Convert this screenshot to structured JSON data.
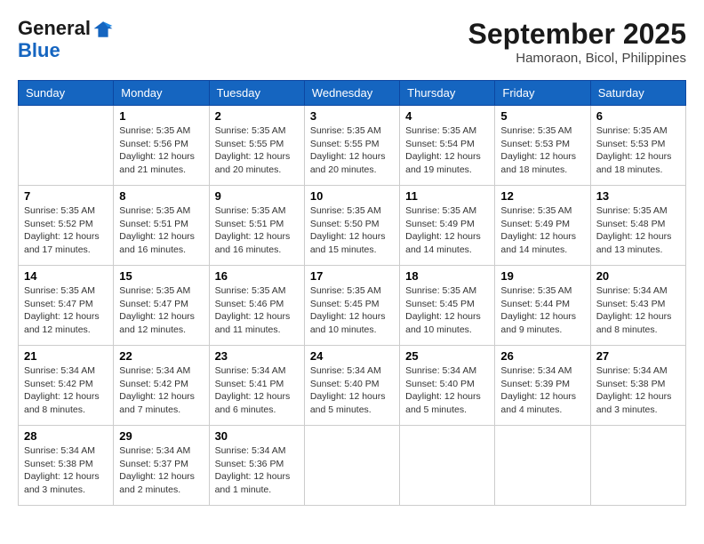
{
  "header": {
    "logo_line1": "General",
    "logo_line2": "Blue",
    "month": "September 2025",
    "location": "Hamoraon, Bicol, Philippines"
  },
  "days_of_week": [
    "Sunday",
    "Monday",
    "Tuesday",
    "Wednesday",
    "Thursday",
    "Friday",
    "Saturday"
  ],
  "weeks": [
    [
      {
        "day": "",
        "info": ""
      },
      {
        "day": "1",
        "info": "Sunrise: 5:35 AM\nSunset: 5:56 PM\nDaylight: 12 hours\nand 21 minutes."
      },
      {
        "day": "2",
        "info": "Sunrise: 5:35 AM\nSunset: 5:55 PM\nDaylight: 12 hours\nand 20 minutes."
      },
      {
        "day": "3",
        "info": "Sunrise: 5:35 AM\nSunset: 5:55 PM\nDaylight: 12 hours\nand 20 minutes."
      },
      {
        "day": "4",
        "info": "Sunrise: 5:35 AM\nSunset: 5:54 PM\nDaylight: 12 hours\nand 19 minutes."
      },
      {
        "day": "5",
        "info": "Sunrise: 5:35 AM\nSunset: 5:53 PM\nDaylight: 12 hours\nand 18 minutes."
      },
      {
        "day": "6",
        "info": "Sunrise: 5:35 AM\nSunset: 5:53 PM\nDaylight: 12 hours\nand 18 minutes."
      }
    ],
    [
      {
        "day": "7",
        "info": "Sunrise: 5:35 AM\nSunset: 5:52 PM\nDaylight: 12 hours\nand 17 minutes."
      },
      {
        "day": "8",
        "info": "Sunrise: 5:35 AM\nSunset: 5:51 PM\nDaylight: 12 hours\nand 16 minutes."
      },
      {
        "day": "9",
        "info": "Sunrise: 5:35 AM\nSunset: 5:51 PM\nDaylight: 12 hours\nand 16 minutes."
      },
      {
        "day": "10",
        "info": "Sunrise: 5:35 AM\nSunset: 5:50 PM\nDaylight: 12 hours\nand 15 minutes."
      },
      {
        "day": "11",
        "info": "Sunrise: 5:35 AM\nSunset: 5:49 PM\nDaylight: 12 hours\nand 14 minutes."
      },
      {
        "day": "12",
        "info": "Sunrise: 5:35 AM\nSunset: 5:49 PM\nDaylight: 12 hours\nand 14 minutes."
      },
      {
        "day": "13",
        "info": "Sunrise: 5:35 AM\nSunset: 5:48 PM\nDaylight: 12 hours\nand 13 minutes."
      }
    ],
    [
      {
        "day": "14",
        "info": "Sunrise: 5:35 AM\nSunset: 5:47 PM\nDaylight: 12 hours\nand 12 minutes."
      },
      {
        "day": "15",
        "info": "Sunrise: 5:35 AM\nSunset: 5:47 PM\nDaylight: 12 hours\nand 12 minutes."
      },
      {
        "day": "16",
        "info": "Sunrise: 5:35 AM\nSunset: 5:46 PM\nDaylight: 12 hours\nand 11 minutes."
      },
      {
        "day": "17",
        "info": "Sunrise: 5:35 AM\nSunset: 5:45 PM\nDaylight: 12 hours\nand 10 minutes."
      },
      {
        "day": "18",
        "info": "Sunrise: 5:35 AM\nSunset: 5:45 PM\nDaylight: 12 hours\nand 10 minutes."
      },
      {
        "day": "19",
        "info": "Sunrise: 5:35 AM\nSunset: 5:44 PM\nDaylight: 12 hours\nand 9 minutes."
      },
      {
        "day": "20",
        "info": "Sunrise: 5:34 AM\nSunset: 5:43 PM\nDaylight: 12 hours\nand 8 minutes."
      }
    ],
    [
      {
        "day": "21",
        "info": "Sunrise: 5:34 AM\nSunset: 5:42 PM\nDaylight: 12 hours\nand 8 minutes."
      },
      {
        "day": "22",
        "info": "Sunrise: 5:34 AM\nSunset: 5:42 PM\nDaylight: 12 hours\nand 7 minutes."
      },
      {
        "day": "23",
        "info": "Sunrise: 5:34 AM\nSunset: 5:41 PM\nDaylight: 12 hours\nand 6 minutes."
      },
      {
        "day": "24",
        "info": "Sunrise: 5:34 AM\nSunset: 5:40 PM\nDaylight: 12 hours\nand 5 minutes."
      },
      {
        "day": "25",
        "info": "Sunrise: 5:34 AM\nSunset: 5:40 PM\nDaylight: 12 hours\nand 5 minutes."
      },
      {
        "day": "26",
        "info": "Sunrise: 5:34 AM\nSunset: 5:39 PM\nDaylight: 12 hours\nand 4 minutes."
      },
      {
        "day": "27",
        "info": "Sunrise: 5:34 AM\nSunset: 5:38 PM\nDaylight: 12 hours\nand 3 minutes."
      }
    ],
    [
      {
        "day": "28",
        "info": "Sunrise: 5:34 AM\nSunset: 5:38 PM\nDaylight: 12 hours\nand 3 minutes."
      },
      {
        "day": "29",
        "info": "Sunrise: 5:34 AM\nSunset: 5:37 PM\nDaylight: 12 hours\nand 2 minutes."
      },
      {
        "day": "30",
        "info": "Sunrise: 5:34 AM\nSunset: 5:36 PM\nDaylight: 12 hours\nand 1 minute."
      },
      {
        "day": "",
        "info": ""
      },
      {
        "day": "",
        "info": ""
      },
      {
        "day": "",
        "info": ""
      },
      {
        "day": "",
        "info": ""
      }
    ]
  ]
}
